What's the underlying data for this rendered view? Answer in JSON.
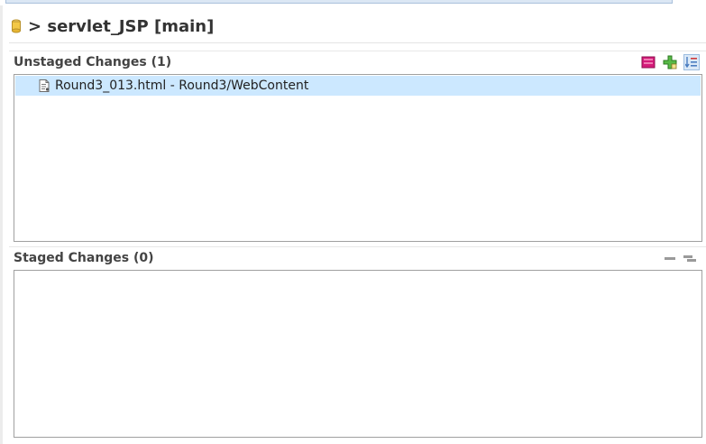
{
  "repository": {
    "title": "> servlet_JSP [main]",
    "icon": "repository-icon"
  },
  "unstaged": {
    "title": "Unstaged Changes (1)",
    "toolbar": [
      {
        "icon": "unstage-icon",
        "color": "#c8186e"
      },
      {
        "icon": "add-icon",
        "color": "#3e9b2f"
      },
      {
        "icon": "sort-list-icon",
        "color": "#4a7cc0",
        "active": true
      }
    ],
    "items": [
      {
        "label": "Round3_013.html - Round3/WebContent",
        "icon": "file-icon"
      }
    ]
  },
  "staged": {
    "title": "Staged Changes (0)",
    "toolbar": [
      {
        "icon": "collapse-icon",
        "color": "#9a9a9a"
      },
      {
        "icon": "tree-icon",
        "color": "#9a9a9a"
      }
    ],
    "items": []
  },
  "colors": {
    "selection": "#cce8ff",
    "border": "#a0a0a0"
  }
}
